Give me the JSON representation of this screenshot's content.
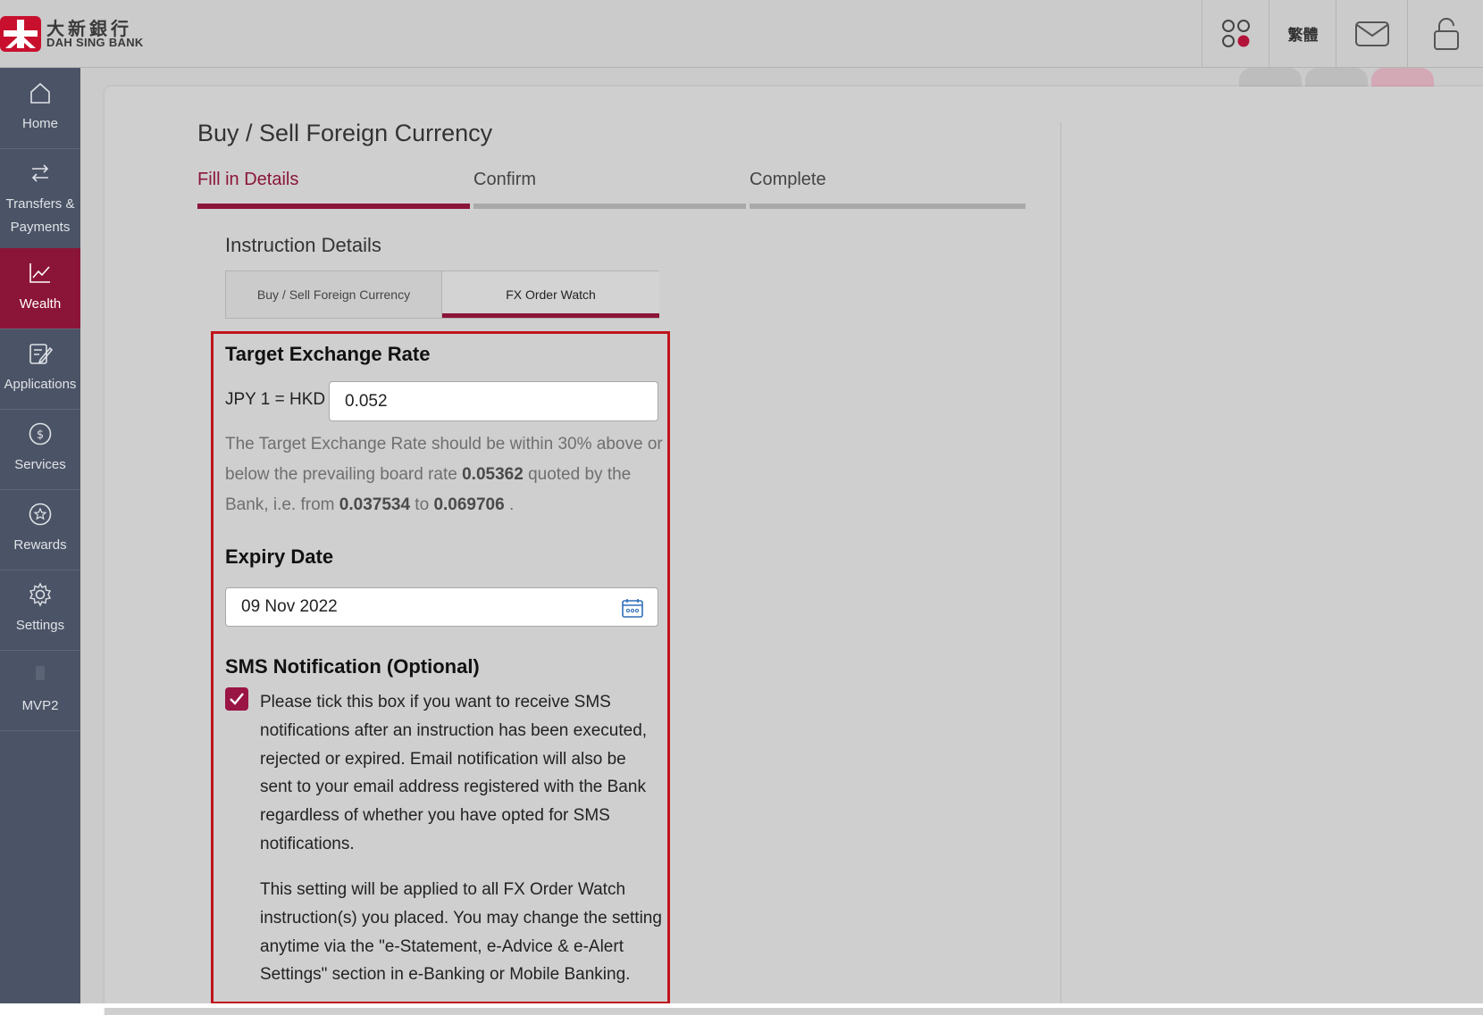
{
  "brand": {
    "name_cn": "大新銀行",
    "name_en": "DAH SING BANK",
    "color": "#c8102e"
  },
  "header": {
    "language_label": "繁體",
    "icons": [
      "apps-icon",
      "mail-icon",
      "lock-icon"
    ]
  },
  "sidebar": {
    "items": [
      {
        "label": "Home",
        "icon": "home-icon",
        "active": false
      },
      {
        "label": "Transfers &\nPayments",
        "icon": "transfer-icon",
        "active": false
      },
      {
        "label": "Wealth",
        "icon": "chart-icon",
        "active": true
      },
      {
        "label": "Applications",
        "icon": "edit-icon",
        "active": false
      },
      {
        "label": "Services",
        "icon": "dollar-icon",
        "active": false
      },
      {
        "label": "Rewards",
        "icon": "star-icon",
        "active": false
      },
      {
        "label": "Settings",
        "icon": "gear-icon",
        "active": false
      },
      {
        "label": "MVP2",
        "icon": "phone-icon",
        "active": false
      }
    ]
  },
  "page": {
    "title": "Buy / Sell Foreign Currency",
    "steps": [
      {
        "label": "Fill in Details",
        "active": true
      },
      {
        "label": "Confirm",
        "active": false
      },
      {
        "label": "Complete",
        "active": false
      }
    ],
    "section_title": "Instruction Details",
    "tabs": [
      {
        "label": "Buy / Sell Foreign Currency",
        "selected": false
      },
      {
        "label": "FX Order Watch",
        "selected": true
      }
    ]
  },
  "form": {
    "target_rate": {
      "heading": "Target Exchange Rate",
      "label": "JPY 1 = HKD",
      "value": "0.052",
      "note_1": "The Target Exchange Rate should be within 30% above or below the prevailing board rate ",
      "board_rate": "0.05362",
      "note_2": " quoted by the Bank, i.e. from ",
      "min": "0.037534",
      "note_3": " to ",
      "max": "0.069706",
      "note_4": " ."
    },
    "expiry": {
      "heading": "Expiry Date",
      "value": "09 Nov 2022"
    },
    "sms": {
      "heading": "SMS Notification (Optional)",
      "checked": true,
      "text_1": "Please tick this box if you want to receive SMS notifications after an instruction has been executed, rejected or expired. Email notification will also be sent to your email address registered with the Bank regardless of whether you have opted for SMS notifications.",
      "text_2": "This setting will be applied to all FX Order Watch instruction(s) you placed. You may change the setting anytime via the \"e-Statement, e-Advice & e-Alert Settings\" section in e-Banking or Mobile Banking."
    }
  },
  "colors": {
    "accent": "#8b1538",
    "highlight": "#c0141c",
    "sidebar": "#4b5466"
  }
}
